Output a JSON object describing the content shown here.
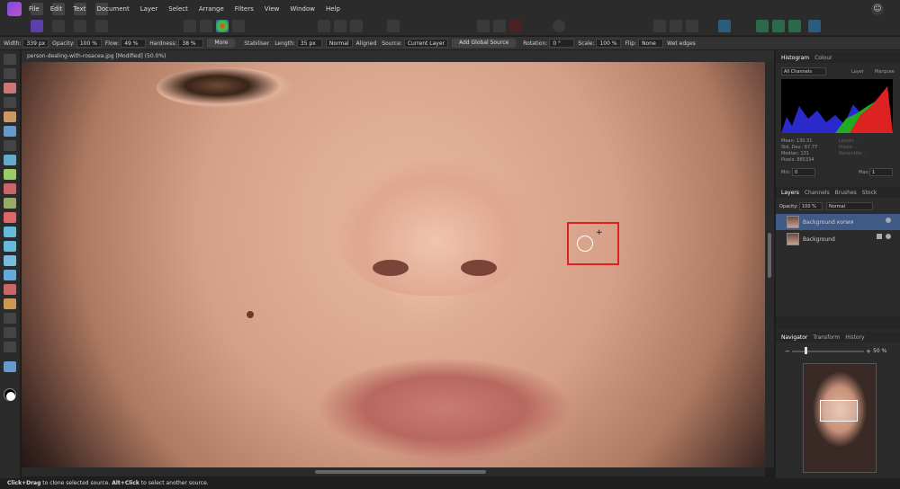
{
  "menu": [
    "File",
    "Edit",
    "Text",
    "Document",
    "Layer",
    "Select",
    "Arrange",
    "Filters",
    "View",
    "Window",
    "Help"
  ],
  "context": {
    "width_label": "Width:",
    "width_value": "339 px",
    "opacity_label": "Opacity:",
    "opacity_value": "100 %",
    "flow_label": "Flow:",
    "flow_value": "49 %",
    "hardness_label": "Hardness:",
    "hardness_value": "38 %",
    "more": "More",
    "stabiliser": "Stabiliser",
    "length_label": "Length:",
    "length_value": "35 px",
    "blend_mode": "Normal",
    "aligned": "Aligned",
    "source_label": "Source:",
    "source_value": "Current Layer",
    "add_global_source": "Add Global Source",
    "rotation_label": "Rotation:",
    "rotation_value": "0 °",
    "scale_label": "Scale:",
    "scale_value": "100 %",
    "flip_label": "Flip:",
    "flip_value": "None",
    "wet_edges": "Wet edges"
  },
  "document": {
    "tab_title": "person-dealing-with-rosacea.jpg [Modified] (50.0%)"
  },
  "status": {
    "drag_bold": "Click+Drag",
    "drag_text": " to clone selected source. ",
    "alt_bold": "Alt+Click",
    "alt_text": " to select another source."
  },
  "histogram": {
    "tabs": [
      "Histogram",
      "Colour"
    ],
    "channel": "All Channels",
    "layer_opt": "Layer",
    "marquee_opt": "Marquee",
    "stats_left": [
      "Mean: 130.31",
      "Std. Dev.: 67.77",
      "Median: 131",
      "Pixels: 865334"
    ],
    "stats_right": [
      "Levels: -",
      "Pixels: -",
      "Percentile: -"
    ],
    "min_label": "Min:",
    "min_value": "0",
    "max_label": "Max:",
    "max_value": "1"
  },
  "layers": {
    "tabs": [
      "Layers",
      "Channels",
      "Brushes",
      "Stock"
    ],
    "opacity_label": "Opacity:",
    "opacity_value": "100 %",
    "blend": "Normal",
    "items": [
      {
        "name": "Background копия",
        "selected": true
      },
      {
        "name": "Background",
        "selected": false
      }
    ]
  },
  "navigator": {
    "tabs": [
      "Navigator",
      "Transform",
      "History"
    ],
    "zoom": "50 %"
  }
}
